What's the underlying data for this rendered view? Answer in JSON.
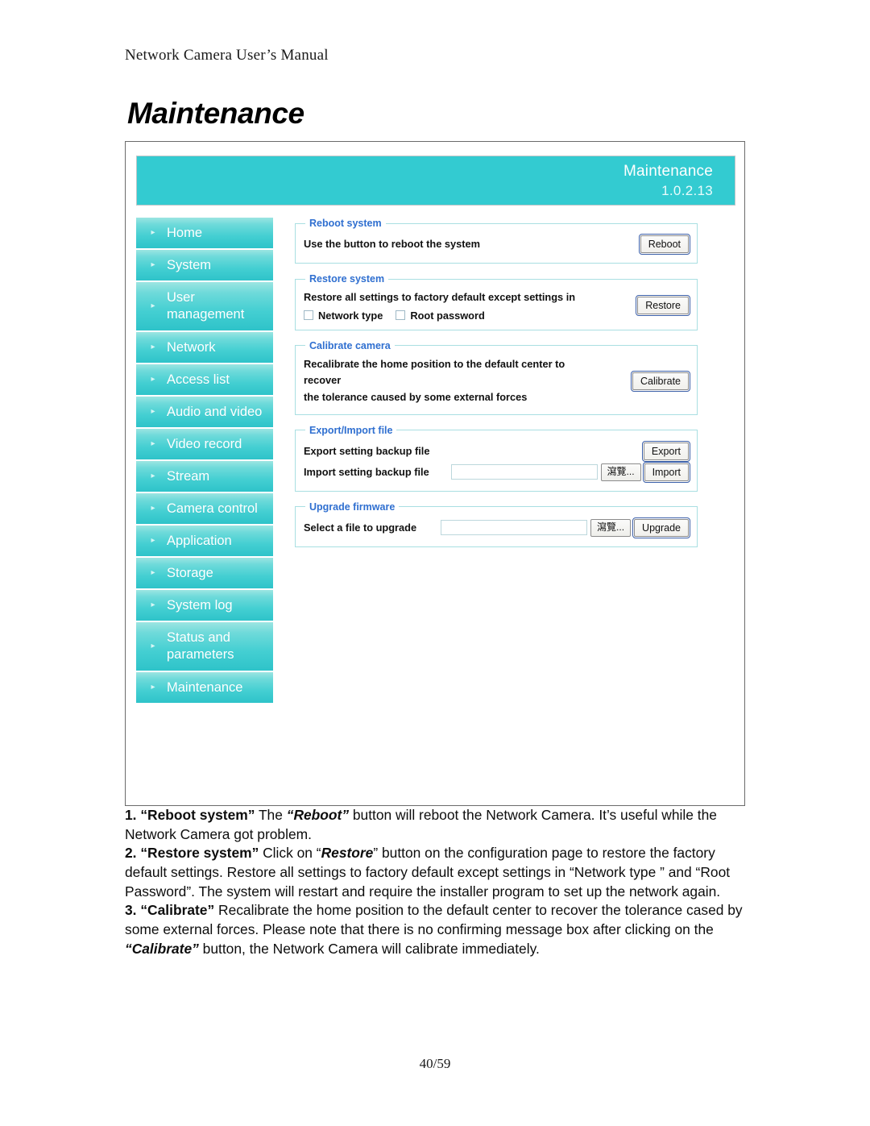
{
  "document": {
    "running_header": "Network Camera User’s Manual",
    "title": "Maintenance",
    "footer": "40/59"
  },
  "screenshot": {
    "banner": {
      "title": "Maintenance",
      "version": "1.0.2.13",
      "bg_color": "#33cbd1"
    },
    "sidebar": {
      "arrow_glyph": "▸",
      "items": [
        {
          "label": "Home",
          "lines": 1
        },
        {
          "label": "System",
          "lines": 1
        },
        {
          "label": "User management",
          "line1": "User",
          "line2": "management",
          "lines": 2
        },
        {
          "label": "Network",
          "lines": 1
        },
        {
          "label": "Access list",
          "lines": 1
        },
        {
          "label": "Audio and video",
          "lines": 1
        },
        {
          "label": "Video record",
          "lines": 1
        },
        {
          "label": "Stream",
          "lines": 1
        },
        {
          "label": "Camera control",
          "lines": 1
        },
        {
          "label": "Application",
          "lines": 1
        },
        {
          "label": "Storage",
          "lines": 1
        },
        {
          "label": "System log",
          "lines": 1
        },
        {
          "label": "Status and parameters",
          "line1": "Status and",
          "line2": "parameters",
          "lines": 2
        },
        {
          "label": "Maintenance",
          "lines": 1
        }
      ]
    },
    "sections": {
      "reboot": {
        "legend": "Reboot system",
        "description": "Use the button to reboot the system",
        "button": "Reboot"
      },
      "restore": {
        "legend": "Restore system",
        "description": "Restore all settings to factory default except settings in",
        "checkbox_network_type": "Network type",
        "checkbox_root_password": "Root password",
        "button": "Restore"
      },
      "calibrate": {
        "legend": "Calibrate camera",
        "description_line1": "Recalibrate the home position to the default center to recover",
        "description_line2": "the tolerance caused by some external forces",
        "button": "Calibrate"
      },
      "export_import": {
        "legend": "Export/Import file",
        "export_label": "Export setting backup file",
        "export_button": "Export",
        "import_label": "Import setting backup file",
        "import_input_value": "",
        "browse_button": "瀉覽...",
        "import_button": "Import"
      },
      "upgrade": {
        "legend": "Upgrade firmware",
        "label": "Select a file to upgrade",
        "input_value": "",
        "browse_button": "瀉覽...",
        "button": "Upgrade"
      }
    }
  },
  "notes": {
    "item1": {
      "number": "1.",
      "term": "“Reboot system”",
      "text_a": " The ",
      "emph": "“Reboot”",
      "text_b": " button will reboot the Network Camera. It’s useful while the Network Camera got problem."
    },
    "item2": {
      "number": "2.",
      "term": "“Restore system”",
      "text_a": " Click on “",
      "emph": "Restore",
      "text_b": "” button on the configuration page to restore the factory default settings. Restore all settings to factory default except settings in “Network type ” and “Root Password”. The system will restart and require the installer program to set up the network again."
    },
    "item3": {
      "number": "3.",
      "term": "“Calibrate”",
      "text_a": " Recalibrate the home position to the default center to recover the tolerance cased by some external forces. Please note that there is no confirming message box after clicking on the ",
      "emph": "“Calibrate”",
      "text_b": " button, the Network Camera will calibrate immediately."
    }
  }
}
